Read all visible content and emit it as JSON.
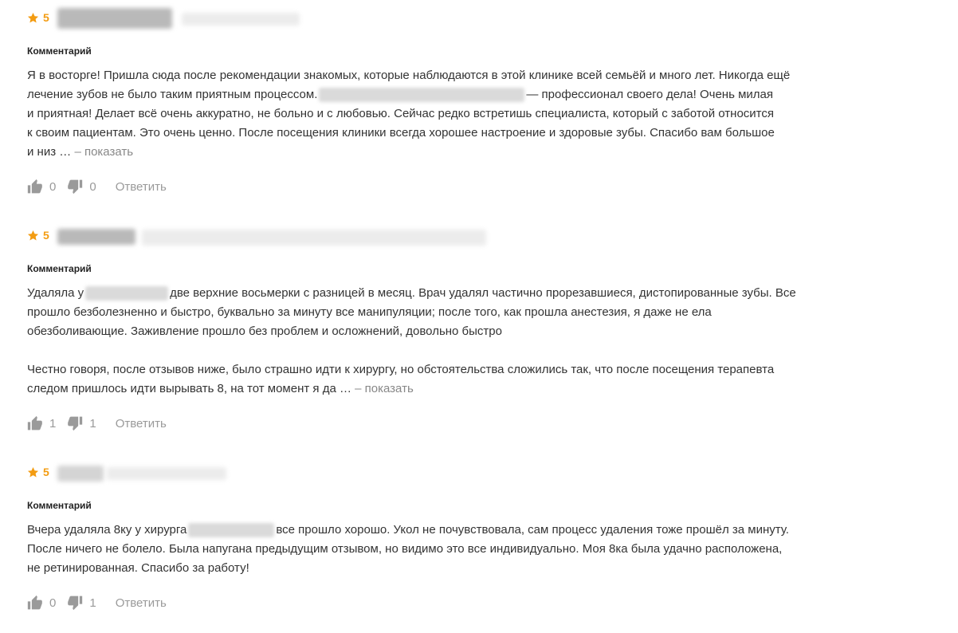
{
  "colors": {
    "accent": "#f39c12",
    "text": "#333333",
    "muted": "#9a9a9a"
  },
  "reviews": [
    {
      "rating": "5",
      "section_label": "Комментарий",
      "lines": [
        [
          "Я в восторге! Пришла сюда после рекомендации знакомых, которые наблюдаются в этой клинике всей семьёй и много лет. Никогда ещё"
        ],
        [
          "лечение зубов не было таким приятным процессом.",
          "— профессионал своего дела! Очень милая"
        ],
        [
          "и приятная! Делает всё очень аккуратно, не больно и с любовью. Сейчас редко встретишь специалиста, который с заботой относится"
        ],
        [
          "к своим пациентам. Это очень ценно. После посещения клиники всегда хорошее настроение и здоровые зубы. Спасибо вам большое"
        ],
        [
          "и низ …"
        ]
      ],
      "show_more": "– показать",
      "likes": "0",
      "dislikes": "0",
      "reply_label": "Ответить"
    },
    {
      "rating": "5",
      "section_label": "Комментарий",
      "lines": [
        [
          "Удаляла у",
          "две верхние восьмерки с разницей в месяц. Врач удалял частично прорезавшиеся, дистопированные зубы. Все"
        ],
        [
          "прошло безболезненно и быстро, буквально за минуту все манипуляции; после того, как прошла анестезия, я даже не ела"
        ],
        [
          "обезболивающие. Заживление прошло без проблем и осложнений, довольно быстро"
        ],
        [
          ""
        ],
        [
          "Честно говоря, после отзывов ниже, было страшно идти к хирургу, но обстоятельства сложились так, что после посещения терапевта"
        ],
        [
          "следом пришлось идти вырывать 8, на тот момент я да …"
        ]
      ],
      "show_more": "– показать",
      "likes": "1",
      "dislikes": "1",
      "reply_label": "Ответить"
    },
    {
      "rating": "5",
      "section_label": "Комментарий",
      "lines": [
        [
          "Вчера удаляла 8ку у хирурга",
          "все прошло хорошо. Укол не почувствовала, сам процесс удаления тоже прошёл за минуту."
        ],
        [
          "После ничего не болело. Была напугана предыдущим отзывом, но видимо это все индивидуально. Моя 8ка была удачно расположена,"
        ],
        [
          "не ретинированная. Спасибо за работу!"
        ]
      ],
      "likes": "0",
      "dislikes": "1",
      "reply_label": "Ответить"
    }
  ]
}
